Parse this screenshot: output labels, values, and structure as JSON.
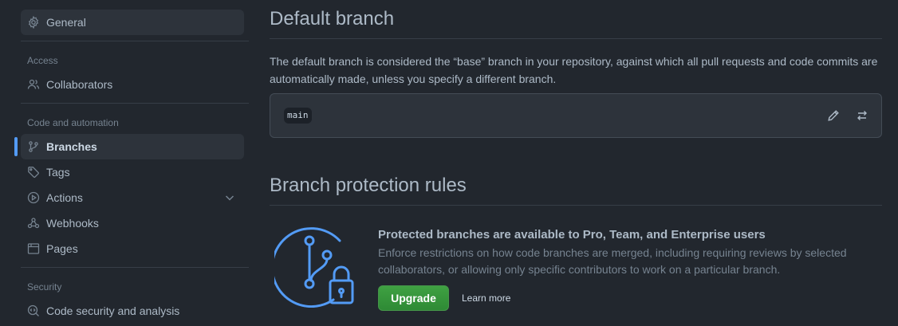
{
  "sidebar": {
    "general": {
      "label": "General",
      "icon": "gear-icon"
    },
    "access_heading": "Access",
    "collaborators": {
      "label": "Collaborators",
      "icon": "people-icon"
    },
    "code_heading": "Code and automation",
    "branches": {
      "label": "Branches",
      "icon": "git-branch-icon"
    },
    "tags": {
      "label": "Tags",
      "icon": "tag-icon"
    },
    "actions": {
      "label": "Actions",
      "icon": "play-icon"
    },
    "webhooks": {
      "label": "Webhooks",
      "icon": "webhook-icon"
    },
    "pages": {
      "label": "Pages",
      "icon": "browser-icon"
    },
    "security_heading": "Security",
    "code_security": {
      "label": "Code security and analysis",
      "icon": "codescan-icon"
    }
  },
  "default_branch": {
    "title": "Default branch",
    "description": "The default branch is considered the “base” branch in your repository, against which all pull requests and code commits are automatically made, unless you specify a different branch.",
    "branch_name": "main",
    "edit_icon": "pencil-icon",
    "switch_icon": "arrow-switch-icon"
  },
  "protection": {
    "title": "Branch protection rules",
    "promo_title": "Protected branches are available to Pro, Team, and Enterprise users",
    "promo_text": "Enforce restrictions on how code branches are merged, including requiring reviews by selected collaborators, or allowing only specific contributors to work on a particular branch.",
    "upgrade_label": "Upgrade",
    "learn_more_label": "Learn more"
  },
  "colors": {
    "background": "#22272e",
    "accent": "#539bf5",
    "upgrade_button": "#347d39"
  }
}
